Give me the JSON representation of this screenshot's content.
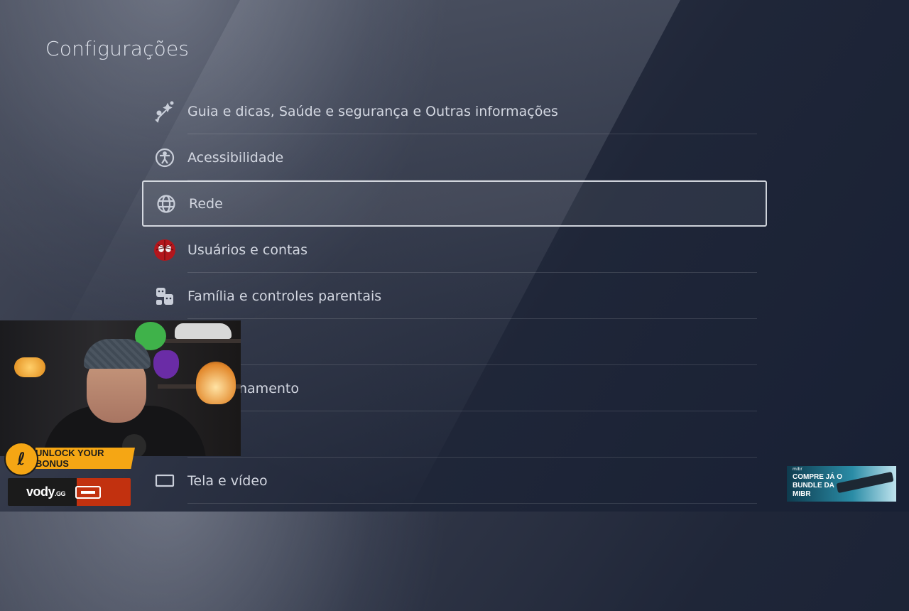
{
  "page": {
    "title": "Configurações"
  },
  "menu": {
    "items": [
      {
        "label": "Guia e dicas, Saúde e segurança e Outras informações",
        "icon": "tips-sparkle-icon",
        "selected": false
      },
      {
        "label": "Acessibilidade",
        "icon": "accessibility-icon",
        "selected": false
      },
      {
        "label": "Rede",
        "icon": "globe-icon",
        "selected": true
      },
      {
        "label": "Usuários e contas",
        "icon": "user-avatar-icon",
        "selected": false
      },
      {
        "label": "Família e controles parentais",
        "icon": "family-faces-icon",
        "selected": false
      },
      {
        "label": "",
        "icon": "",
        "selected": false
      },
      {
        "label": "namento",
        "icon": "",
        "selected": false
      },
      {
        "label": "",
        "icon": "",
        "selected": false
      },
      {
        "label": "Tela e vídeo",
        "icon": "screen-icon",
        "selected": false
      }
    ]
  },
  "overlay": {
    "bonus_text": "UNLOCK YOUR BONUS",
    "vody_brand": "vody",
    "vody_suffix": ".GG",
    "promo_brand": "mibr",
    "promo_text": "COMPRE JÁ O BUNDLE DA MIBR"
  },
  "colors": {
    "background_dark": "#1f2638",
    "selection_border": "#ebeef5",
    "bonus_orange": "#f5a614",
    "vody_red": "#c2310f"
  }
}
